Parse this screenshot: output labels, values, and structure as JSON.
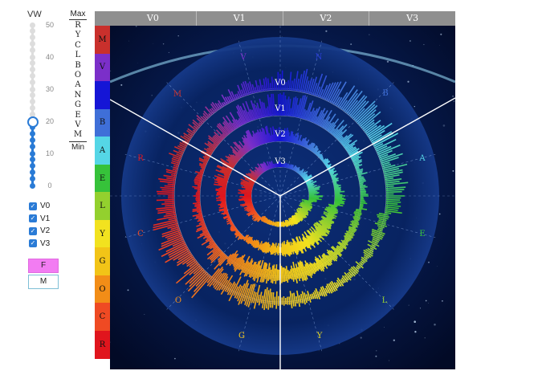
{
  "slider": {
    "title": "VW",
    "ticks": [
      "50",
      "40",
      "30",
      "20",
      "10",
      "0"
    ],
    "value": 20
  },
  "scale": {
    "max_label": "Max",
    "min_label": "Min",
    "letters": [
      "R",
      "Y",
      "C",
      "L",
      "B",
      "O",
      "A",
      "N",
      "G",
      "E",
      "V",
      "M"
    ]
  },
  "versions": [
    {
      "label": "V0",
      "checked": true
    },
    {
      "label": "V1",
      "checked": true
    },
    {
      "label": "V2",
      "checked": true
    },
    {
      "label": "V3",
      "checked": true
    }
  ],
  "mode_buttons": {
    "f_label": "F",
    "m_label": "M",
    "active": "F"
  },
  "tabs": [
    "V0",
    "V1",
    "V2",
    "V3"
  ],
  "strip": [
    {
      "letter": "M",
      "color": "#c9302c"
    },
    {
      "letter": "V",
      "color": "#7b2fc9"
    },
    {
      "letter": "",
      "color": "#1515d6"
    },
    {
      "letter": "B",
      "color": "#3f6fd8"
    },
    {
      "letter": "A",
      "color": "#55d6e6"
    },
    {
      "letter": "E",
      "color": "#36c23a"
    },
    {
      "letter": "L",
      "color": "#93d02e"
    },
    {
      "letter": "Y",
      "color": "#f2e21f"
    },
    {
      "letter": "G",
      "color": "#f2c417"
    },
    {
      "letter": "O",
      "color": "#f28d17"
    },
    {
      "letter": "C",
      "color": "#ef4a23"
    },
    {
      "letter": "R",
      "color": "#e0151d"
    }
  ],
  "ring_labels": [
    "V0",
    "V1",
    "V2",
    "V3"
  ],
  "sector_labels": [
    {
      "text": "V",
      "color": "#7b2fc9"
    },
    {
      "text": "N",
      "color": "#2a3fd8"
    },
    {
      "text": "B",
      "color": "#3f6fd8"
    },
    {
      "text": "A",
      "color": "#55d6e6"
    },
    {
      "text": "E",
      "color": "#36c23a"
    },
    {
      "text": "L",
      "color": "#93d02e"
    },
    {
      "text": "Y",
      "color": "#f2e21f"
    },
    {
      "text": "G",
      "color": "#f2c417"
    },
    {
      "text": "O",
      "color": "#f28d17"
    },
    {
      "text": "C",
      "color": "#ef4a23"
    },
    {
      "text": "R",
      "color": "#e0151d"
    },
    {
      "text": "M",
      "color": "#c9302c"
    }
  ]
}
